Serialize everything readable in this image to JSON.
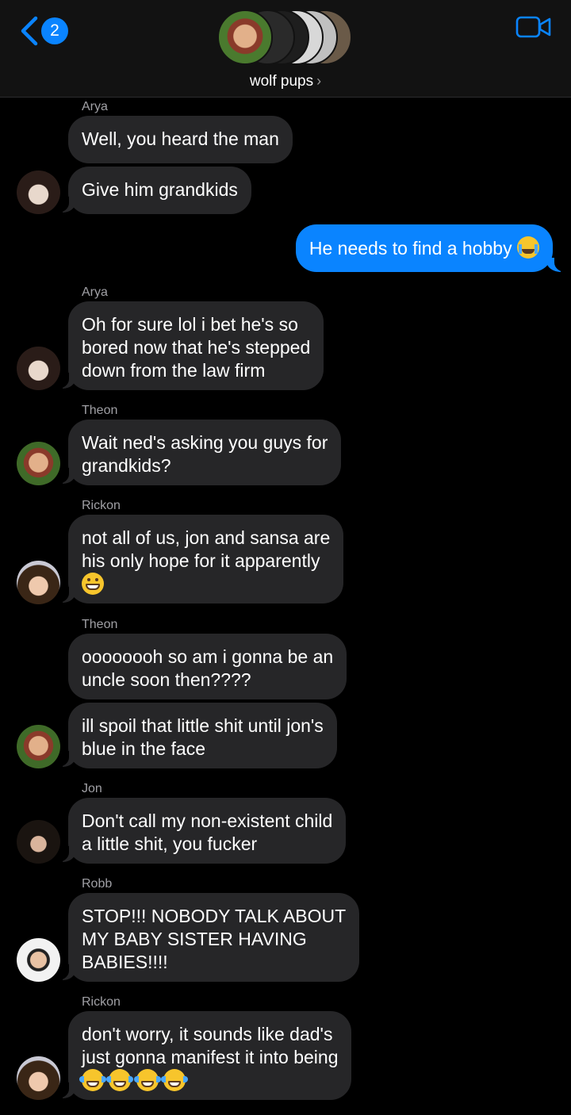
{
  "header": {
    "back_count": "2",
    "group_name": "wolf pups",
    "member_avatar_colors": [
      "#4a7a2e",
      "#2a2a2a",
      "#1e1e1e",
      "#d8d8d8",
      "#c0c0c0",
      "#6a5a48"
    ]
  },
  "colors": {
    "accent": "#0a84ff",
    "incoming_bubble": "#262628",
    "background": "#000000",
    "sender_text": "#a0a0a5"
  },
  "messages": [
    {
      "sender": "Arya",
      "text": "Well, you heard the man"
    },
    {
      "text": "Give him grandkids"
    },
    {
      "outgoing": true,
      "text": "He needs to find a hobby",
      "emoji": "loudly-crying-face"
    },
    {
      "sender": "Arya",
      "line1": "Oh for sure lol i bet he's so",
      "line2": "bored now that he's stepped",
      "line3": "down from the law firm"
    },
    {
      "sender": "Theon",
      "line1": "Wait ned's asking you guys for",
      "line2": "grandkids?"
    },
    {
      "sender": "Rickon",
      "line1": "not all of us, jon and sansa are",
      "line2": "his only hope for it apparently",
      "emoji": "grinning-face"
    },
    {
      "sender": "Theon",
      "line1": "oooooooh so am i gonna be an",
      "line2": "uncle soon then????"
    },
    {
      "line1": "ill spoil that little shit until jon's",
      "line2": "blue in the face"
    },
    {
      "sender": "Jon",
      "line1": "Don't call my non-existent child",
      "line2": "a little shit, you fucker"
    },
    {
      "sender": "Robb",
      "line1": "STOP!!! NOBODY TALK ABOUT",
      "line2": "MY BABY SISTER HAVING",
      "line3": "BABIES!!!!"
    },
    {
      "sender": "Rickon",
      "line1": "don't worry, it sounds like dad's",
      "line2": "just gonna manifest it into being",
      "emoji": "face-with-tears-of-joy"
    }
  ]
}
